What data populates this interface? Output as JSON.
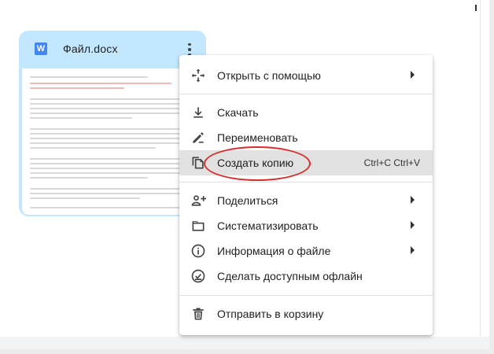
{
  "file": {
    "name": "Файл.docx",
    "type_badge": "W"
  },
  "menu": {
    "items": [
      {
        "label": "Открыть с помощью",
        "icon": "move-arrows-icon",
        "submenu": true
      },
      {
        "label": "Скачать",
        "icon": "download-icon",
        "submenu": false
      },
      {
        "label": "Переименовать",
        "icon": "pencil-icon",
        "submenu": false
      },
      {
        "label": "Создать копию",
        "icon": "copy-icon",
        "submenu": false,
        "shortcut": "Ctrl+C Ctrl+V",
        "highlighted": true
      },
      {
        "label": "Поделиться",
        "icon": "add-person-icon",
        "submenu": true
      },
      {
        "label": "Систематизировать",
        "icon": "folder-icon",
        "submenu": true
      },
      {
        "label": "Информация о файле",
        "icon": "info-icon",
        "submenu": true
      },
      {
        "label": "Сделать доступным офлайн",
        "icon": "offline-check-icon",
        "submenu": false
      },
      {
        "label": "Отправить в корзину",
        "icon": "trash-icon",
        "submenu": false
      }
    ]
  },
  "colors": {
    "card_bg": "#c2e7ff",
    "word_blue": "#4285f4",
    "highlight_red": "#d32f2f",
    "active_row": "#e1e1e1"
  }
}
